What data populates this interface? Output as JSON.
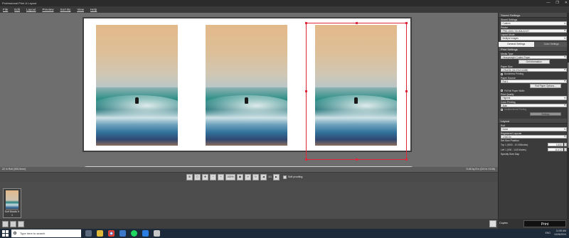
{
  "window": {
    "title": "Professional Print & Layout",
    "controls": [
      "—",
      "❐",
      "✕"
    ]
  },
  "menu": [
    "File",
    "Edit",
    "Layout",
    "Preview",
    "Sort By",
    "View",
    "Help"
  ],
  "canvas": {
    "status_left": "22 in Roll (305.5mm)",
    "status_right": "5.46 by 8 in (DH in X108)"
  },
  "toolbar": {
    "zoom": "100%",
    "page": "1/1",
    "softproof_label": "Soft proofing"
  },
  "thumbnail": {
    "caption": "Surf Moods H",
    "count": "3"
  },
  "panel": {
    "stored_settings_header": "Stored Settings",
    "stored_settings_label": "Stored Settings",
    "stored_settings_value": "Custom",
    "printer_label": "Printer",
    "printer_value": "PRO-1000 / 00-00A-02-E7",
    "layout_mode_label": "Layout Mode",
    "layout_mode_value": "Multiple Images",
    "tabs": [
      "General Settings",
      "Color Settings"
    ],
    "print_settings_header": "Print Settings",
    "media_type_label": "Media Type",
    "media_type_value": "Heavyweight Coated Paper",
    "get_info_button": "Get Information",
    "paper_size_label": "Paper Size",
    "paper_size_value": "2 Roll Br (18.07in/1418B)",
    "borderless_label": "Borderless Printing",
    "paper_source_label": "Paper Source",
    "paper_source_value": "Roll 1",
    "roll_options_button": "Roll Paper Options...",
    "fit_roll_label": "Fit Roll Paper Width",
    "print_quality_label": "Print Quality",
    "print_quality_value": "Highest",
    "color_printing_label": "Color Printing",
    "color_printing_value": "Auto",
    "unidirectional_label": "Unidirectional Printing",
    "settings_button": "Settings",
    "layout_header": "Layout",
    "roll_label": "Roll",
    "roll_value": "None",
    "registered_layouts_label": "Registered Layouts",
    "registered_layouts_value": "1.0x0.0x",
    "setsize_label": "Set Size Position",
    "top_label": "Top 1 (0000 - 10.00Modes)",
    "top_value": "0.400",
    "left_label": "Left 1 (000 - 14.8 Modes)",
    "left_value": "10.472",
    "specify_label": "Specify Size Gap"
  },
  "print": {
    "copies_label": "Copies",
    "print_button": "Print"
  },
  "taskbar": {
    "search_placeholder": "Type here to search",
    "time": "11:55 AM",
    "date": "10/26/2024",
    "lang": "ENG"
  }
}
